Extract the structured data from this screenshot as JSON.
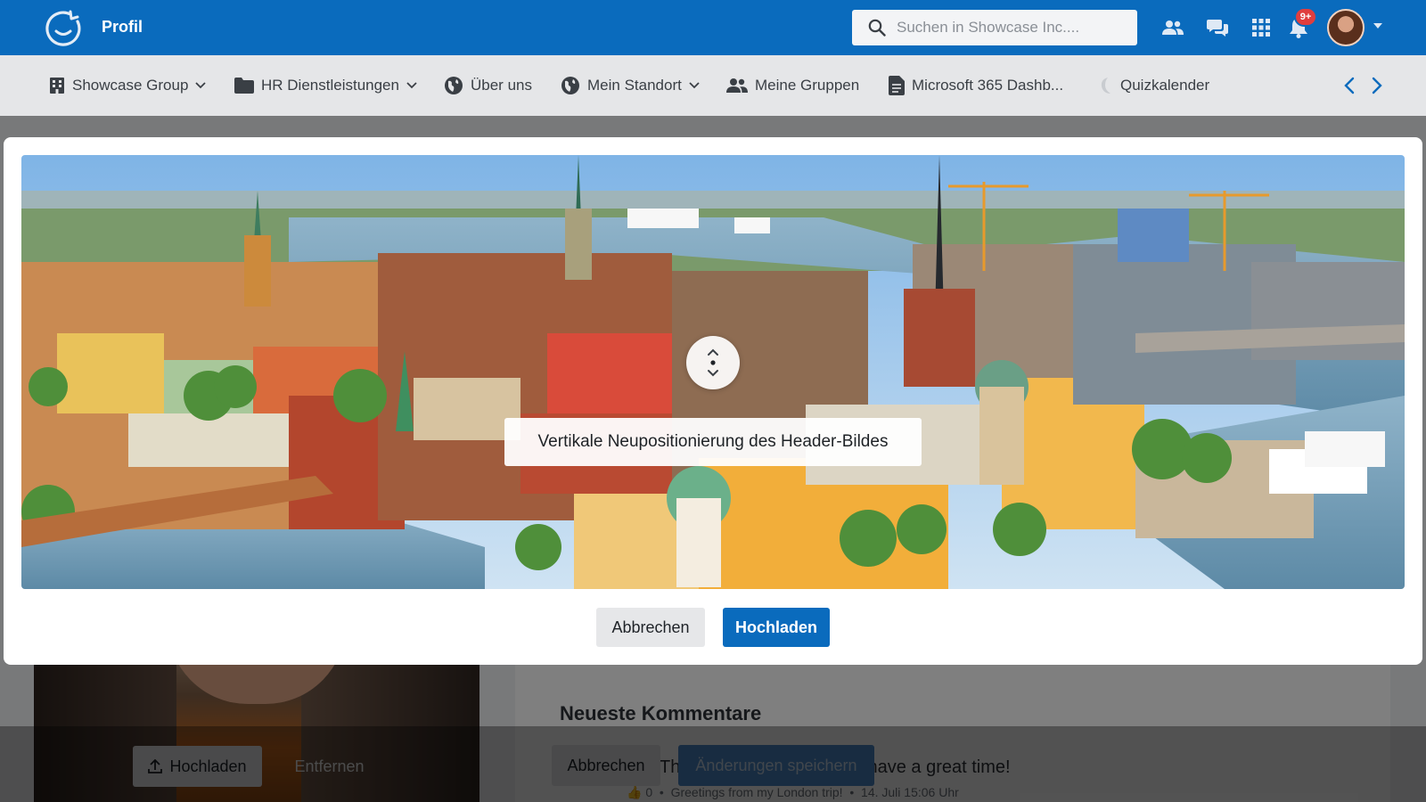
{
  "app": {
    "title": "Profil"
  },
  "search": {
    "placeholder": "Suchen in Showcase Inc...."
  },
  "notifications": {
    "badge": "9+"
  },
  "nav": {
    "items": [
      {
        "label": "Showcase Group",
        "icon": "building-icon",
        "dropdown": true
      },
      {
        "label": "HR Dienstleistungen",
        "icon": "folder-icon",
        "dropdown": true
      },
      {
        "label": "Über uns",
        "icon": "globe-icon",
        "dropdown": false
      },
      {
        "label": "Mein Standort",
        "icon": "globe-icon",
        "dropdown": true
      },
      {
        "label": "Meine Gruppen",
        "icon": "users-icon",
        "dropdown": false
      },
      {
        "label": "Microsoft 365 Dashb...",
        "icon": "document-icon",
        "dropdown": false
      },
      {
        "label": "Quizkalender",
        "icon": "moon-icon",
        "dropdown": false
      }
    ]
  },
  "modal": {
    "reposition_label": "Vertikale Neupositionierung des Header-Bildes",
    "cancel_label": "Abbrechen",
    "upload_label": "Hochladen"
  },
  "background": {
    "comments_title": "Neueste Kommentare",
    "comment_text": "Thanks so nice, hope you have a great time!",
    "comment_likes": "0",
    "comment_post": "Greetings from my London trip!",
    "comment_time": "14. Juli 15:06 Uhr",
    "photo_upload_label": "Hochladen",
    "photo_remove_label": "Entfernen",
    "cancel_label": "Abbrechen",
    "save_label": "Änderungen speichern"
  },
  "colors": {
    "brand": "#0a6bbd",
    "badge": "#e03e3e"
  }
}
